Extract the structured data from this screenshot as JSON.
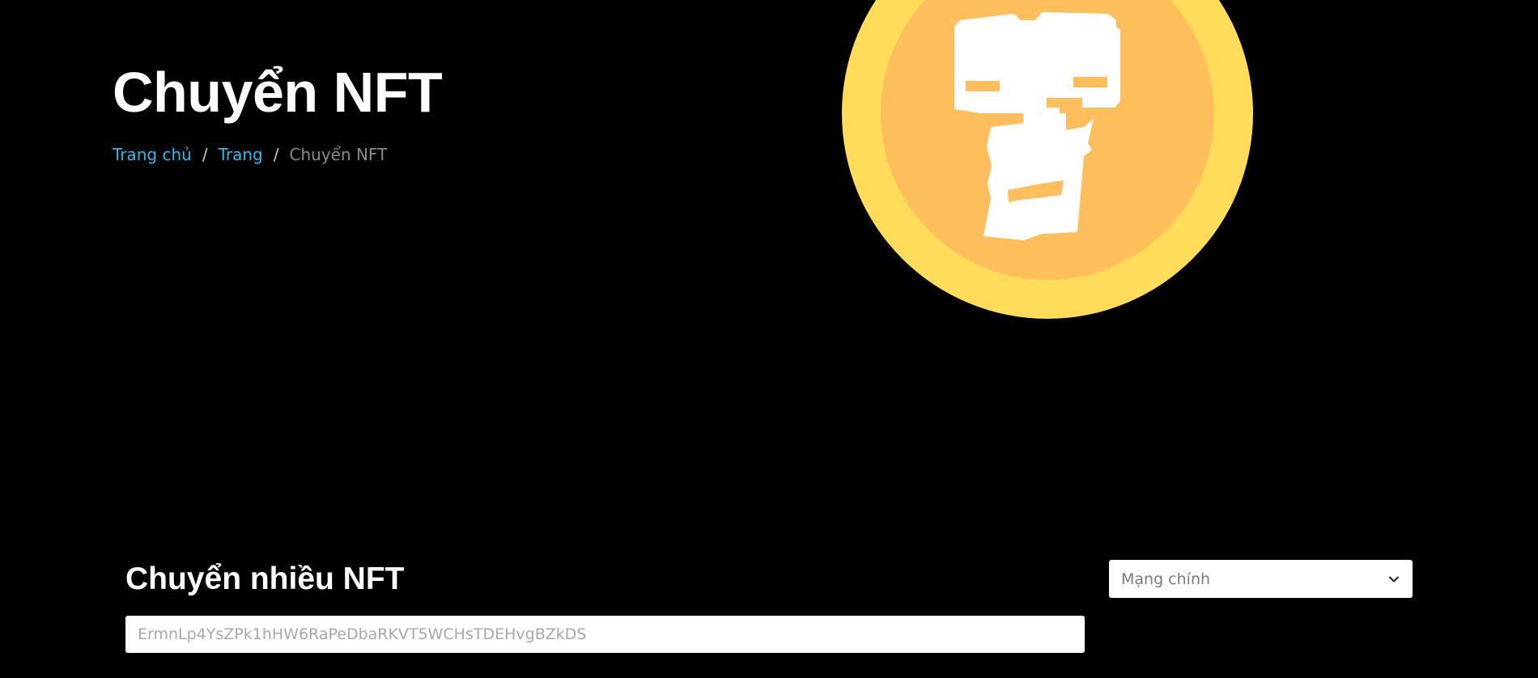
{
  "header": {
    "title": "Chuyển NFT",
    "breadcrumb": [
      {
        "label": "Trang chủ"
      },
      {
        "label": "Trang"
      },
      {
        "label": "Chuyển NFT"
      }
    ],
    "separator": "/"
  },
  "hero_image": {
    "icon": "nft-coin-logo",
    "colors": {
      "outer_ring": "#FFDC5A",
      "inner_disc": "#FFBE5C",
      "glyph": "#FFFFFF"
    }
  },
  "transfer": {
    "section_title": "Chuyển nhiều NFT",
    "network_select": {
      "selected": "Mạng chính",
      "icon": "chevron-down-icon"
    },
    "address_input": {
      "value": "",
      "placeholder": "ErmnLp4YsZPk1hHW6RaPeDbaRKVT5WCHsTDEHvgBZkDS"
    }
  },
  "colors": {
    "background": "#000000",
    "link": "#2FB8E8",
    "heading": "#FFFFFF",
    "breadcrumb_current": "#8A8A8A"
  }
}
